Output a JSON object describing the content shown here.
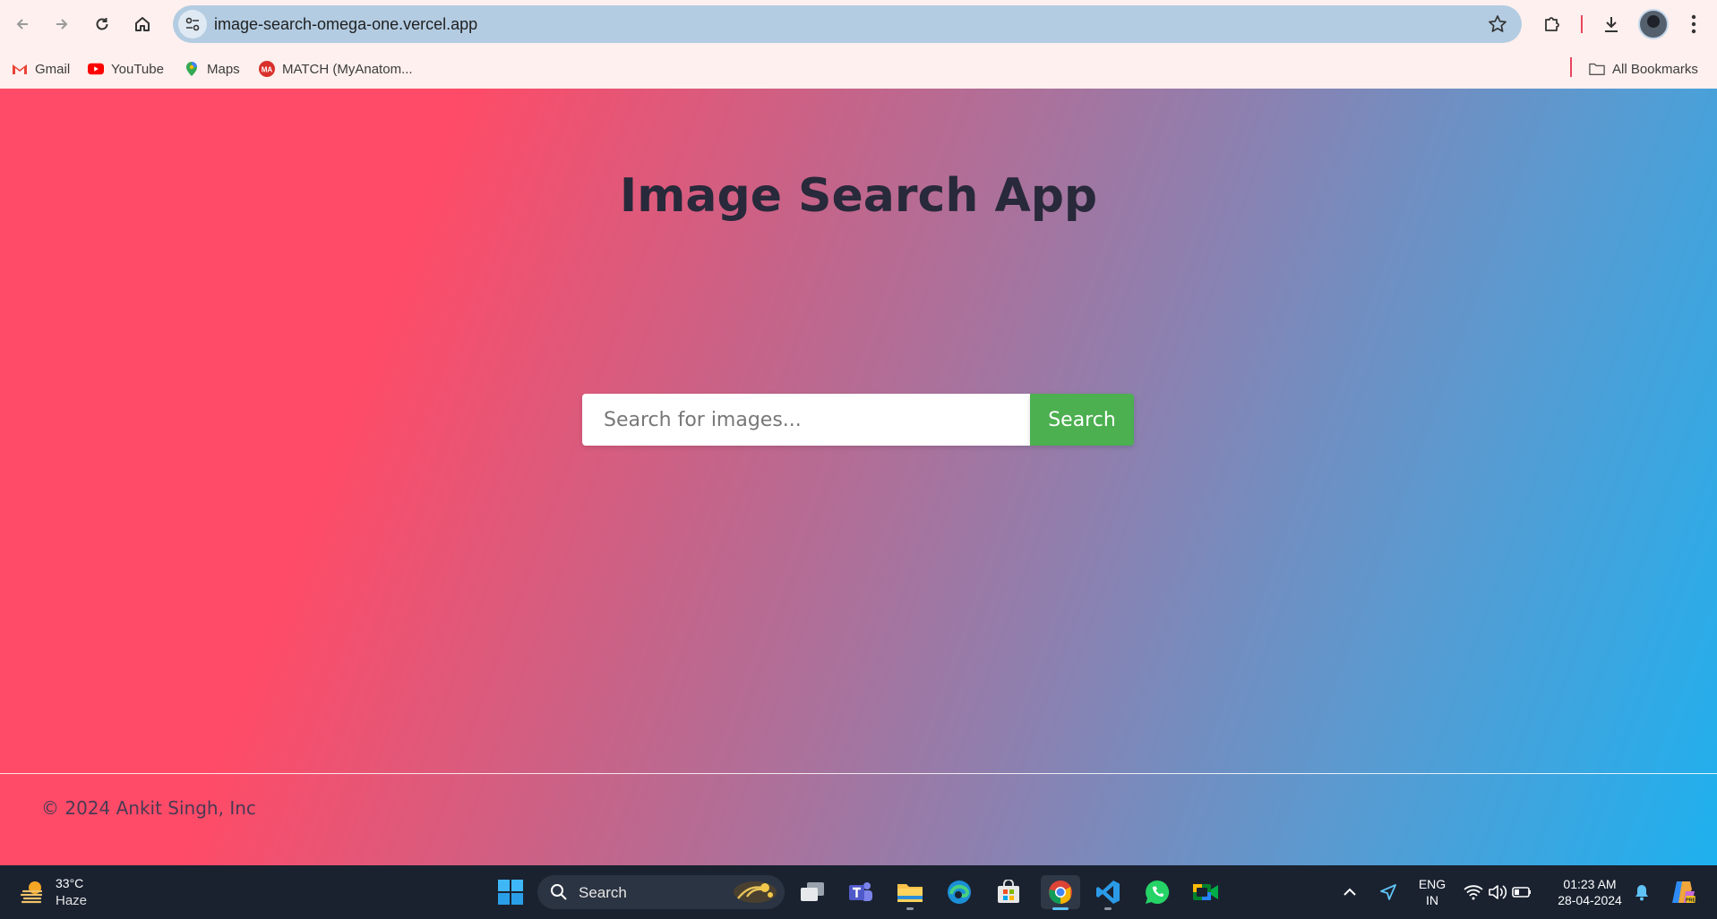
{
  "browser": {
    "url": "image-search-omega-one.vercel.app",
    "bookmarks": [
      {
        "label": "Gmail",
        "icon": "gmail-icon"
      },
      {
        "label": "YouTube",
        "icon": "youtube-icon"
      },
      {
        "label": "Maps",
        "icon": "maps-icon"
      },
      {
        "label": "MATCH (MyAnatom...",
        "icon": "match-icon"
      }
    ],
    "all_bookmarks": "All Bookmarks"
  },
  "page": {
    "title": "Image Search App",
    "search_placeholder": "Search for images...",
    "search_button": "Search",
    "footer": "© 2024 Ankit Singh, Inc",
    "colors": {
      "gradient_start": "#ff4b67",
      "gradient_end": "#1eb1ef",
      "button": "#4caf50",
      "title": "#28293a"
    }
  },
  "taskbar": {
    "weather_temp": "33°C",
    "weather_condition": "Haze",
    "search_label": "Search",
    "language_line1": "ENG",
    "language_line2": "IN",
    "time": "01:23 AM",
    "date": "28-04-2024"
  }
}
